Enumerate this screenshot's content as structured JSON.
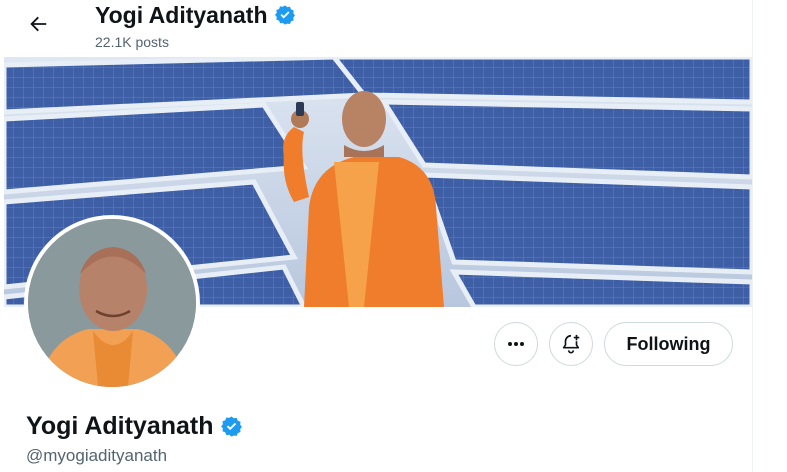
{
  "header": {
    "name": "Yogi Adityanath",
    "posts": "22.1K posts"
  },
  "profile": {
    "name": "Yogi Adityanath",
    "handle": "@myogiadityanath"
  },
  "actions": {
    "follow_label": "Following"
  },
  "icons": {
    "back": "arrow-left-icon",
    "verified": "verified-badge-icon",
    "more": "more-horizontal-icon",
    "notify": "bell-plus-icon"
  },
  "colors": {
    "verified": "#1d9bf0",
    "text": "#0f1419",
    "secondary": "#536471",
    "border": "#cfd9de"
  }
}
